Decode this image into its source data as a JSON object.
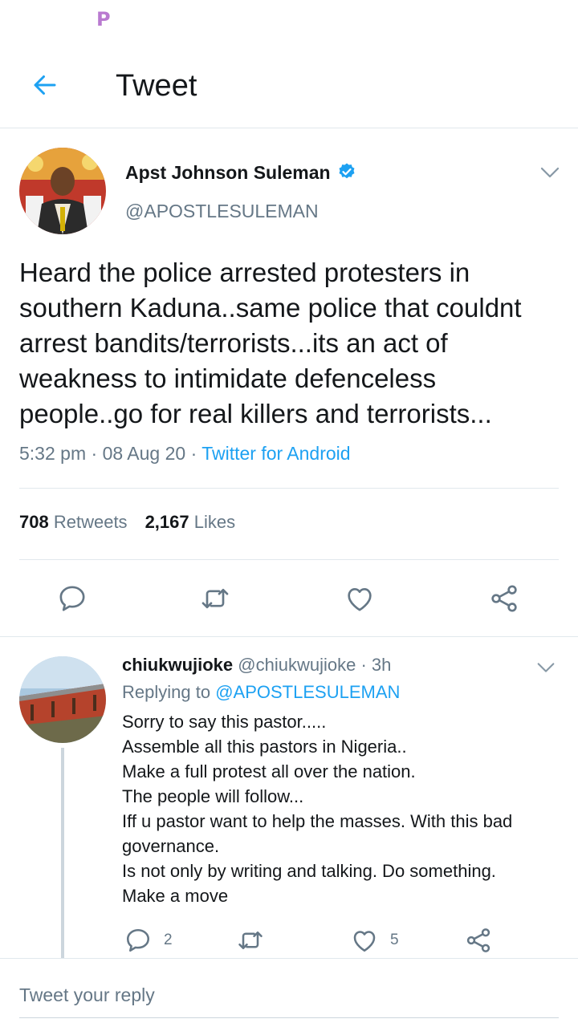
{
  "status_bar": {
    "logo_letter": "P"
  },
  "header": {
    "title": "Tweet"
  },
  "tweet": {
    "author_name": "Apst Johnson Suleman",
    "handle": "@APOSTLESULEMAN",
    "text": "Heard the police arrested protesters in southern Kaduna..same police that couldnt arrest bandits/terrorists...its an act of weakness to intimidate defenceless people..go for real killers and terrorists...",
    "time": "5:32 pm",
    "date": "08 Aug 20",
    "client": "Twitter for Android",
    "retweets_count": "708",
    "retweets_label": "Retweets",
    "likes_count": "2,167",
    "likes_label": "Likes"
  },
  "reply": {
    "name": "chiukwujioke",
    "handle": "@chiukwujioke",
    "time": "3h",
    "replying_label": "Replying to",
    "replying_to": "@APOSTLESULEMAN",
    "lines": [
      "Sorry to say this pastor.....",
      "Assemble all this pastors in Nigeria..",
      "Make a full protest all over the nation.",
      "The people will follow...",
      "Iff u pastor want to help the masses. With this bad governance.",
      "Is not only by writing and talking. Do something.",
      "Make a move"
    ],
    "reply_count": "2",
    "like_count": "5"
  },
  "composer": {
    "placeholder": "Tweet your reply"
  },
  "colors": {
    "accent": "#1da1f2",
    "secondary_text": "#657786",
    "divider": "#e1e8ed"
  },
  "icons": [
    "back-arrow-icon",
    "verified-badge-icon",
    "chevron-down-icon",
    "reply-icon",
    "retweet-icon",
    "like-icon",
    "share-icon"
  ]
}
